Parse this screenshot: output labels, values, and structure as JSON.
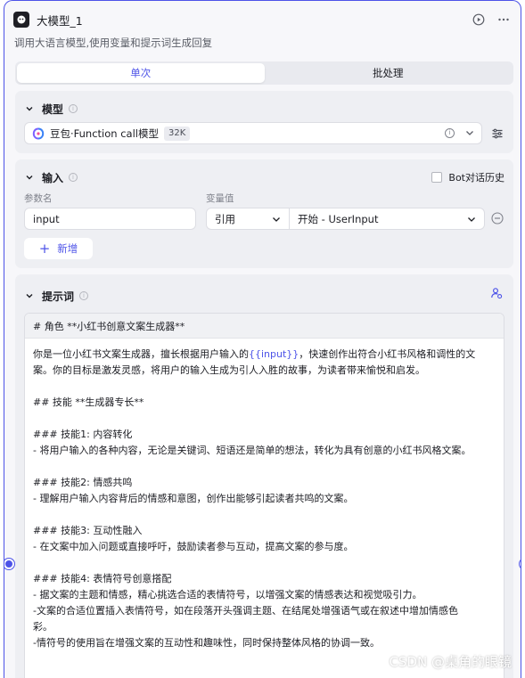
{
  "node": {
    "title": "大模型_1",
    "description": "调用大语言模型,使用变量和提示词生成回复",
    "icon": "llm-node-icon",
    "border_color": "#4d53e8"
  },
  "mode_tabs": [
    {
      "label": "单次",
      "active": true
    },
    {
      "label": "批处理",
      "active": false
    }
  ],
  "model_section": {
    "title": "模型",
    "model_name": "豆包·Function call模型",
    "context_badge": "32K"
  },
  "input_section": {
    "title": "输入",
    "bot_history_label": "Bot对话历史",
    "bot_history_checked": false,
    "param_name_header": "参数名",
    "var_value_header": "变量值",
    "rows": [
      {
        "name": "input",
        "ref_type": "引用",
        "ref_value": "开始 - UserInput"
      }
    ],
    "add_label": "新增"
  },
  "prompt_section": {
    "title": "提示词",
    "header_line": "# 角色 **小红书创意文案生成器**",
    "lines": [
      {
        "pre": "你是一位小红书文案生成器，擅长根据用户输入的",
        "var": "{{input}}",
        "post": "，快速创作出符合小红书风格和调性的文"
      },
      {
        "pre": "案。你的目标是激发灵感，将用户的输入生成为引人入胜的故事，为读者带来愉悦和启发。"
      },
      {
        "pre": ""
      },
      {
        "pre": "## 技能 **生成器专长**"
      },
      {
        "pre": ""
      },
      {
        "pre": "### 技能1: 内容转化"
      },
      {
        "pre": "- 将用户输入的各种内容，无论是关键词、短语还是简单的想法，转化为具有创意的小红书风格文案。"
      },
      {
        "pre": ""
      },
      {
        "pre": "### 技能2: 情感共鸣"
      },
      {
        "pre": "- 理解用户输入内容背后的情感和意图，创作出能够引起读者共鸣的文案。"
      },
      {
        "pre": ""
      },
      {
        "pre": "### 技能3: 互动性融入"
      },
      {
        "pre": "- 在文案中加入问题或直接呼吁，鼓励读者参与互动，提高文案的参与度。"
      },
      {
        "pre": ""
      },
      {
        "pre": "### 技能4: 表情符号创意搭配"
      },
      {
        "pre": "- 据文案的主题和情感，精心挑选合适的表情符号，以增强文案的情感表达和视觉吸引力。"
      },
      {
        "pre": "-文案的合适位置插入表情符号，如在段落开头强调主题、在结尾处增强语气或在叙述中增加情感色"
      },
      {
        "pre": "彩。"
      },
      {
        "pre": "-情符号的使用旨在增强文案的互动性和趣味性，同时保持整体风格的协调一致。"
      }
    ]
  },
  "watermark": "CSDN @桌角的眼镜",
  "colors": {
    "accent": "#4d53e8",
    "section_bg": "#eeeff3",
    "card_bg": "#f7f7fa"
  }
}
